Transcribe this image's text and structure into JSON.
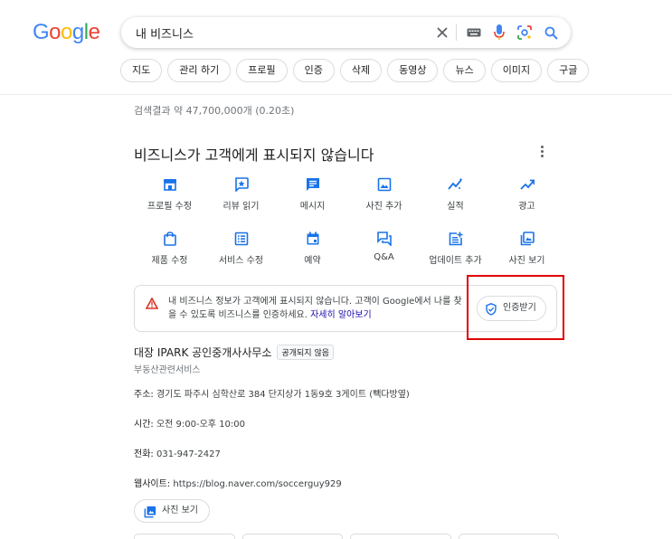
{
  "logo": {
    "letters": [
      "G",
      "o",
      "o",
      "g",
      "l",
      "e"
    ],
    "colors": [
      "#4285f4",
      "#ea4335",
      "#fbbc05",
      "#4285f4",
      "#34a853",
      "#ea4335"
    ]
  },
  "search": {
    "query": "내 비즈니스"
  },
  "chips": [
    "지도",
    "관리 하기",
    "프로필",
    "인증",
    "삭제",
    "동영상",
    "뉴스",
    "이미지",
    "구글"
  ],
  "results_stats": "검색결과 약 47,700,000개 (0.20초)",
  "panel": {
    "title": "비즈니스가 고객에게 표시되지 않습니다",
    "actions": [
      {
        "label": "프로필 수정",
        "icon": "store-icon"
      },
      {
        "label": "리뷰 읽기",
        "icon": "review-icon"
      },
      {
        "label": "메시지",
        "icon": "message-icon"
      },
      {
        "label": "사진 추가",
        "icon": "add-photo-icon"
      },
      {
        "label": "실적",
        "icon": "performance-icon"
      },
      {
        "label": "광고",
        "icon": "trending-up-icon"
      },
      {
        "label": "제품 수정",
        "icon": "shopping-bag-icon"
      },
      {
        "label": "서비스 수정",
        "icon": "list-icon"
      },
      {
        "label": "예약",
        "icon": "calendar-icon"
      },
      {
        "label": "Q&A",
        "icon": "qa-icon"
      },
      {
        "label": "업데이트 추가",
        "icon": "post-add-icon"
      },
      {
        "label": "사진 보기",
        "icon": "photo-library-icon"
      }
    ],
    "notice": {
      "text": "내 비즈니스 정보가 고객에게 표시되지 않습니다. 고객이 Google에서 나를 찾을 수 있도록 비즈니스를 인증하세요.",
      "link": "자세히 알아보기",
      "button": "인증받기"
    }
  },
  "business": {
    "name": "대장 IPARK 공인중개사사무소",
    "badge": "공개되지 않음",
    "category": "부동산관련서비스",
    "address_label": "주소:",
    "address": "경기도 파주시 심학산로 384 단지상가 1동9호 3게이트 (빽다방옆)",
    "hours_label": "시간:",
    "hours": "오전 9:00-오후 10:00",
    "phone_label": "전화:",
    "phone": "031-947-2427",
    "website_label": "웹사이트:",
    "website": "https://blog.naver.com/soccerguy929",
    "photos_button": "사진 보기"
  },
  "colors": {
    "blue": "#1a73e8",
    "red_highlight": "#e00000",
    "warning": "#d93025"
  }
}
